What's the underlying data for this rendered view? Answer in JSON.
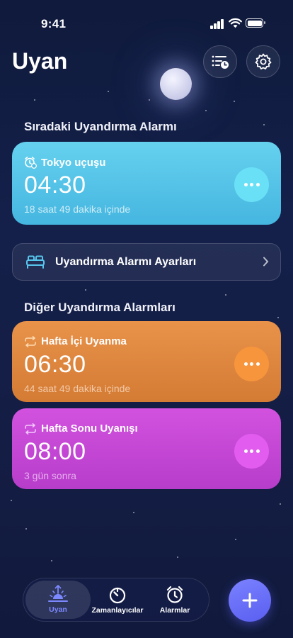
{
  "status_bar": {
    "time": "9:41"
  },
  "header": {
    "title": "Uyan"
  },
  "next_alarm_section": {
    "title": "Sıradaki Uyandırma Alarmı"
  },
  "next_alarm": {
    "label": "Tokyo uçuşu",
    "time": "04:30",
    "subtitle": "18 saat 49 dakika içinde",
    "color": "#5ccbea"
  },
  "settings_row": {
    "label": "Uyandırma Alarmı Ayarları"
  },
  "other_alarms_section": {
    "title": "Diğer Uyandırma Alarmları"
  },
  "other_alarms": [
    {
      "label": "Hafta İçi Uyanma",
      "time": "06:30",
      "subtitle": "44 saat 49 dakika içinde",
      "color": "#e0883e"
    },
    {
      "label": "Hafta Sonu Uyanışı",
      "time": "08:00",
      "subtitle": "3 gün sonra",
      "color": "#c84ad7"
    }
  ],
  "tab_bar": {
    "tabs": [
      {
        "label": "Uyan",
        "icon": "sunrise-icon",
        "active": true,
        "color": "#7b88ff"
      },
      {
        "label": "Zamanlayıcılar",
        "icon": "timer-icon",
        "active": false
      },
      {
        "label": "Alarmlar",
        "icon": "alarm-clock-icon",
        "active": false
      }
    ]
  },
  "fab": {
    "icon": "plus-icon",
    "color": "#6a70f7"
  }
}
